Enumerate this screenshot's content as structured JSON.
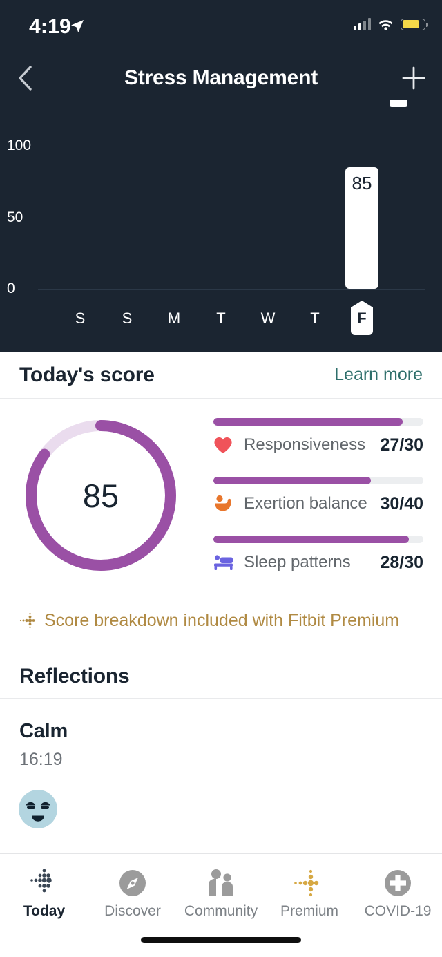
{
  "status_bar": {
    "time": "4:19",
    "location_icon": "location-arrow-icon",
    "signal_icon": "cellular-signal-icon",
    "wifi_icon": "wifi-icon",
    "battery_icon": "battery-icon",
    "battery_color": "#f5d949"
  },
  "nav": {
    "back_icon": "chevron-left-icon",
    "title": "Stress Management",
    "add_icon": "plus-icon"
  },
  "chart_data": {
    "type": "bar",
    "title": "Stress Management weekly scores",
    "categories": [
      "S",
      "S",
      "M",
      "T",
      "W",
      "T",
      "F"
    ],
    "values": [
      null,
      null,
      null,
      null,
      null,
      null,
      85
    ],
    "value_labels": [
      "",
      "",
      "",
      "",
      "",
      "",
      "85"
    ],
    "selected_index": 6,
    "xlabel": "",
    "ylabel": "",
    "ylim": [
      0,
      125
    ],
    "yticks": [
      0,
      50,
      100
    ],
    "ytick_labels": [
      "0",
      "50",
      "100"
    ],
    "grid": true,
    "legend": "none",
    "bar_color": "#ffffff",
    "background": "#1b2531"
  },
  "todays_score": {
    "heading": "Today's score",
    "learn_more": "Learn more",
    "ring": {
      "value": "85",
      "percent": 85,
      "fill_color": "#9a50a5",
      "track_color": "#eadcee"
    },
    "metrics": [
      {
        "icon": "heart-icon",
        "icon_color": "#f0535a",
        "label": "Responsiveness",
        "value": "27/30",
        "percent": 90
      },
      {
        "icon": "exertion-figure-icon",
        "icon_color": "#e8762c",
        "label": "Exertion balance",
        "value": "30/40",
        "percent": 75
      },
      {
        "icon": "bed-icon",
        "icon_color": "#6a63e0",
        "label": "Sleep patterns",
        "value": "28/30",
        "percent": 93
      }
    ],
    "premium_note": {
      "icon": "premium-sparkle-icon",
      "text": "Score breakdown included with Fitbit Premium",
      "color": "#b08a43"
    }
  },
  "reflections": {
    "heading": "Reflections",
    "entries": [
      {
        "name": "Calm",
        "time": "16:19",
        "face_icon": "calm-face-icon",
        "face_color": "#b3d5e0"
      }
    ]
  },
  "tabbar": {
    "items": [
      {
        "icon": "fitbit-dots-icon",
        "label": "Today",
        "active": true
      },
      {
        "icon": "compass-icon",
        "label": "Discover",
        "active": false
      },
      {
        "icon": "people-icon",
        "label": "Community",
        "active": false
      },
      {
        "icon": "premium-sparkle-icon",
        "label": "Premium",
        "active": false
      },
      {
        "icon": "medical-cross-icon",
        "label": "COVID-19",
        "active": false
      }
    ],
    "home_indicator": "home-indicator"
  }
}
